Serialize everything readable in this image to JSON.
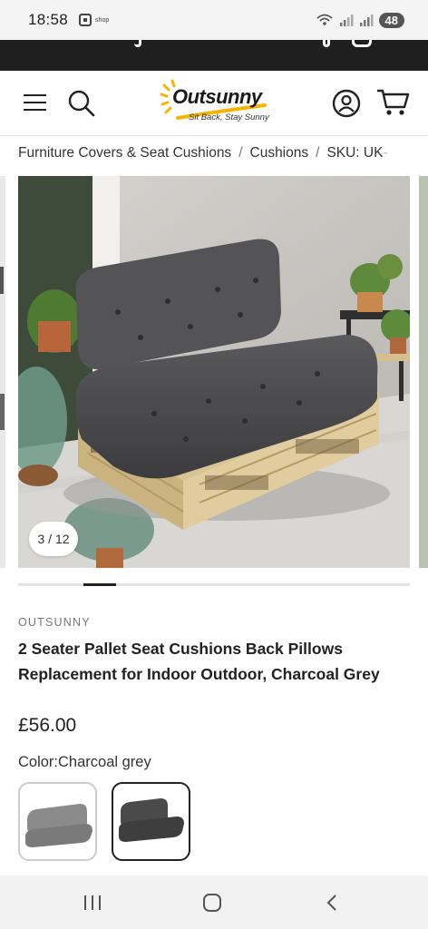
{
  "status_bar": {
    "time": "18:58",
    "app_label": "shop",
    "battery": "48"
  },
  "header": {
    "logo_text": "Outsunny",
    "logo_tagline": "Sit Back, Stay Sunny"
  },
  "breadcrumb": {
    "items": [
      "Furniture Covers & Seat Cushions",
      "Cushions"
    ],
    "sku_prefix": "SKU: UK",
    "sku_fade": "-"
  },
  "gallery": {
    "counter": "3 / 12",
    "progress": 0.0833
  },
  "product": {
    "brand": "OUTSUNNY",
    "title": "2 Seater Pallet Seat Cushions Back Pillows Replacement for Indoor Outdoor, Charcoal Grey",
    "price": "£56.00",
    "color_label": "Color:",
    "color_value": "Charcoal grey",
    "swatches": [
      {
        "name": "light-grey-swatch",
        "color": "#8a8a8a"
      },
      {
        "name": "charcoal-grey-swatch",
        "color": "#4a4a4a"
      }
    ]
  },
  "colors": {
    "cushion": "#4b4b4d",
    "pallet": "#dcc79a",
    "wall": "#c9c6c2",
    "floor": "#d9d7d3"
  }
}
